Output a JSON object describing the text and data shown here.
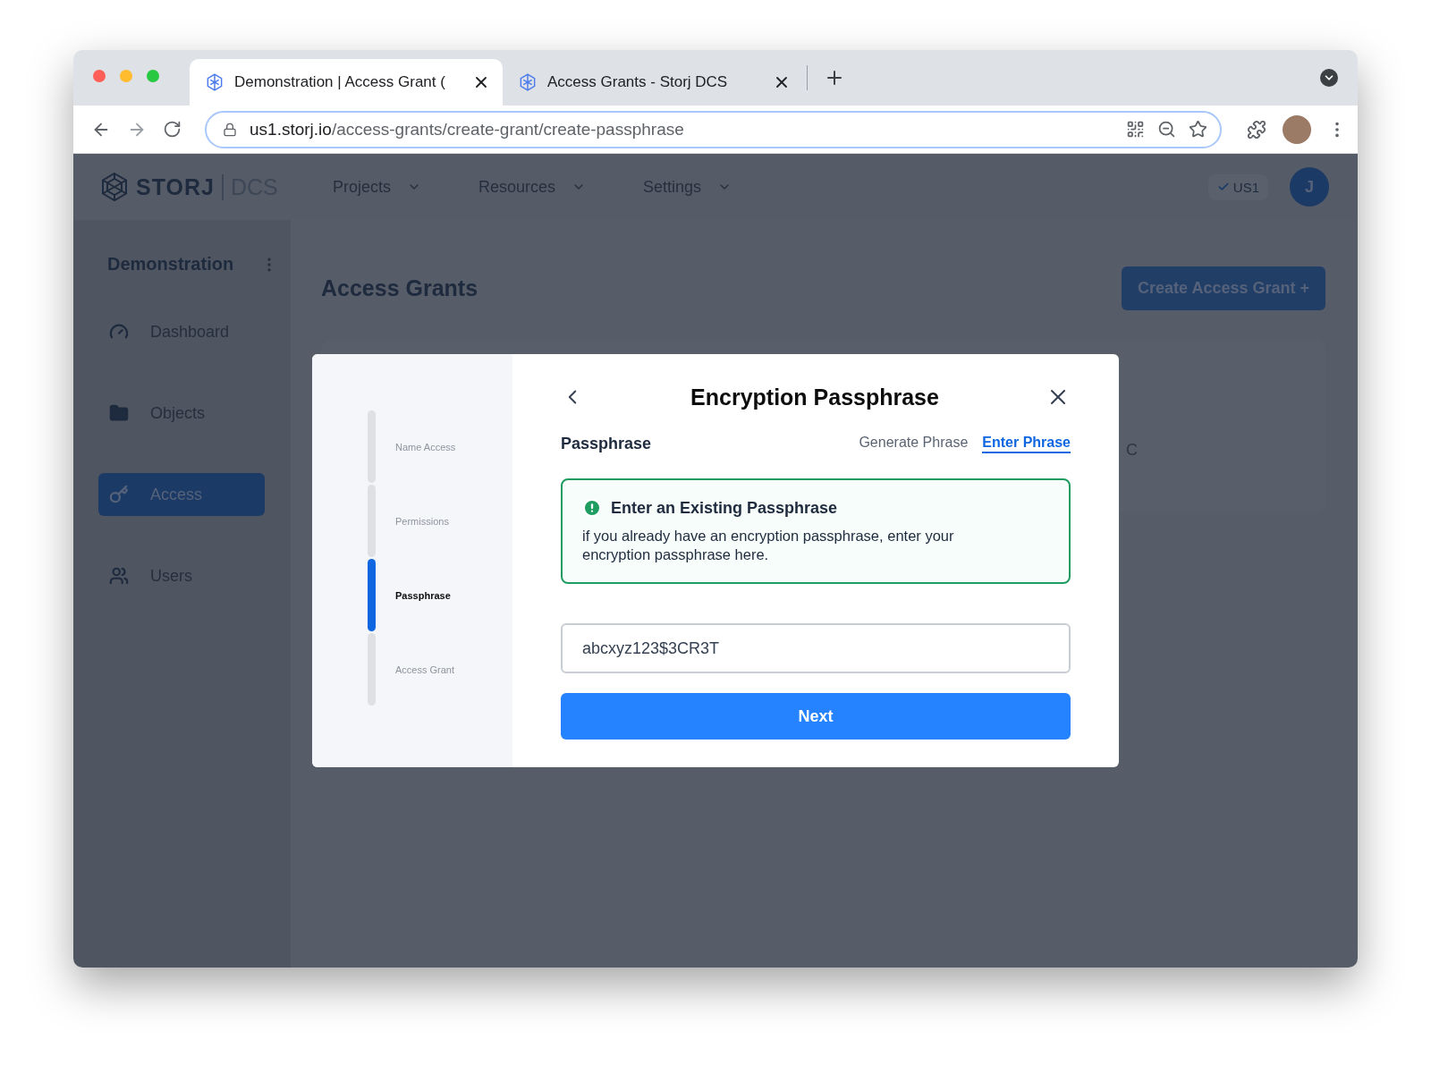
{
  "browser": {
    "tabs": [
      {
        "title": "Demonstration | Access Grant (",
        "selected": true
      },
      {
        "title": "Access Grants - Storj DCS",
        "selected": false
      }
    ],
    "address": {
      "host": "us1.storj.io",
      "path": "/access-grants/create-grant/create-passphrase"
    }
  },
  "header": {
    "logo": {
      "brand": "STORJ",
      "product": "DCS"
    },
    "nav": [
      {
        "label": "Projects"
      },
      {
        "label": "Resources"
      },
      {
        "label": "Settings"
      }
    ],
    "region": "US1",
    "avatar": "J"
  },
  "sidebar": {
    "project": "Demonstration",
    "items": [
      {
        "label": "Dashboard",
        "selected": false
      },
      {
        "label": "Objects",
        "selected": false
      },
      {
        "label": "Access",
        "selected": true
      },
      {
        "label": "Users",
        "selected": false
      }
    ]
  },
  "main": {
    "title": "Access Grants",
    "create_button": "Create Access Grant +",
    "card_text": "C"
  },
  "modal": {
    "steps": [
      {
        "label": "Name Access",
        "selected": false
      },
      {
        "label": "Permissions",
        "selected": false
      },
      {
        "label": "Passphrase",
        "selected": true
      },
      {
        "label": "Access Grant",
        "selected": false
      }
    ],
    "title": "Encryption Passphrase",
    "section_label": "Passphrase",
    "options": [
      {
        "label": "Generate Phrase",
        "selected": false
      },
      {
        "label": "Enter Phrase",
        "selected": true
      }
    ],
    "notice": {
      "title": "Enter an Existing Passphrase",
      "body": "if you already have an encryption passphrase, enter your encryption passphrase here."
    },
    "input": {
      "value": "abcxyz123$3CR3T"
    },
    "button": "Next"
  }
}
